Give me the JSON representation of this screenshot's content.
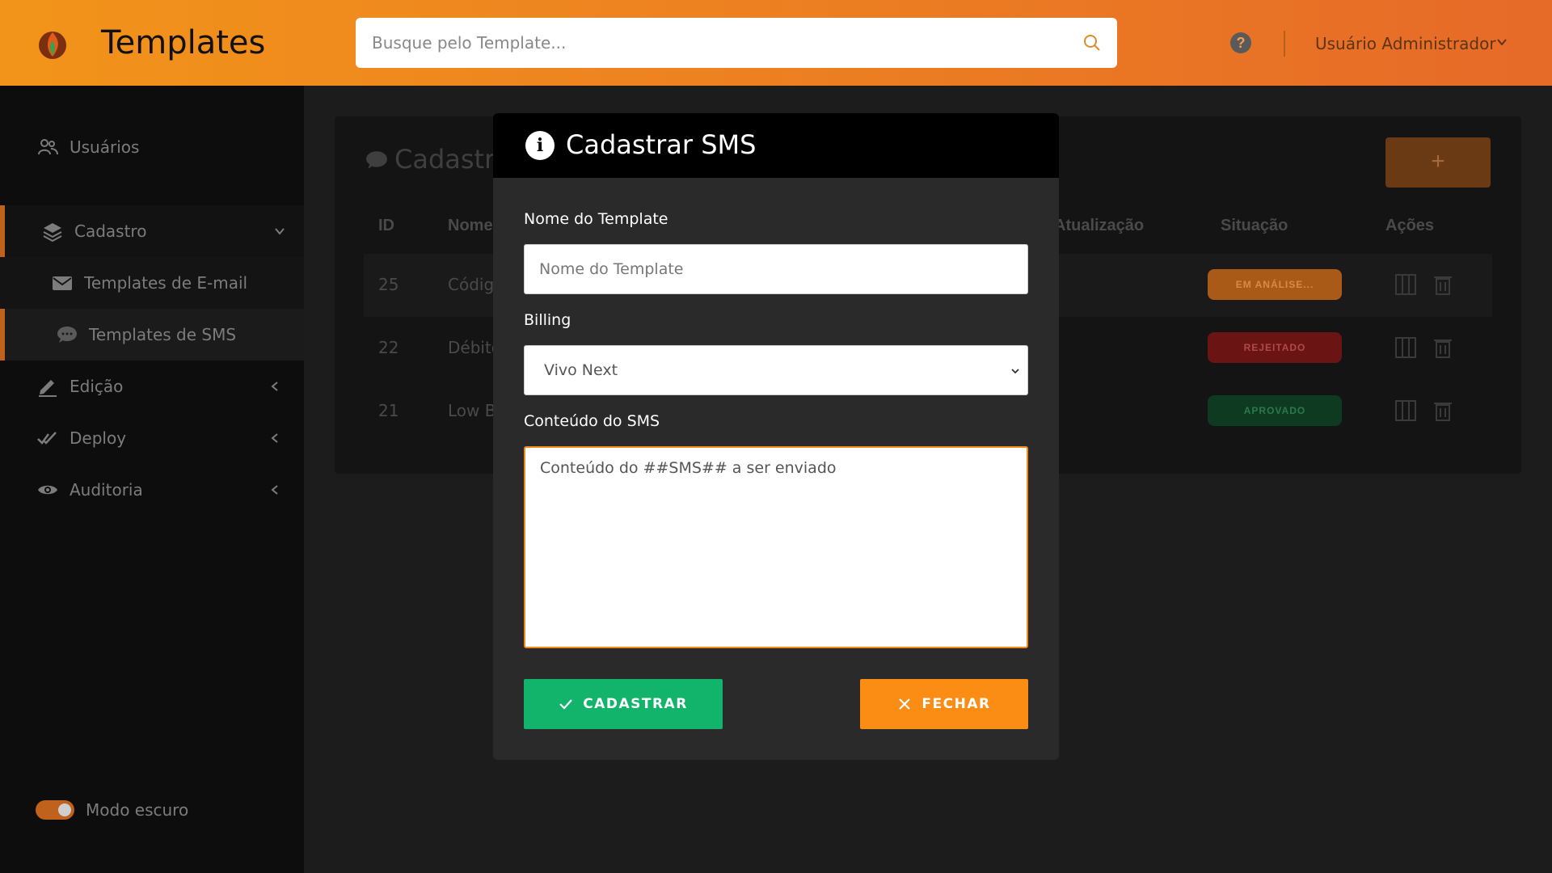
{
  "header": {
    "title": "Templates",
    "search_placeholder": "Busque pelo Template...",
    "help_glyph": "?",
    "user_name": "Usuário Administrador"
  },
  "sidebar": {
    "items": [
      {
        "label": "Usuários",
        "icon": "users-icon"
      },
      {
        "label": "Cadastro",
        "icon": "layers-icon"
      },
      {
        "label": "Templates de E-mail",
        "icon": "envelope-icon"
      },
      {
        "label": "Templates de SMS",
        "icon": "chat-bubble-icon"
      },
      {
        "label": "Edição",
        "icon": "pencil-icon"
      },
      {
        "label": "Deploy",
        "icon": "double-check-icon"
      },
      {
        "label": "Auditoria",
        "icon": "eye-icon"
      }
    ],
    "dark_mode_label": "Modo escuro"
  },
  "panel": {
    "title": "Cadastro",
    "add_glyph": "+",
    "columns": [
      "ID",
      "Nome",
      "Atualização",
      "Situação",
      "Ações"
    ],
    "rows": [
      {
        "id": "25",
        "name": "Códig",
        "status": "EM ANÁLISE...",
        "status_color": "#a85a16",
        "status_text": "#d88a4a"
      },
      {
        "id": "22",
        "name": "Débito",
        "status": "REJEITADO",
        "status_color": "#6a1414",
        "status_text": "#b04a4a"
      },
      {
        "id": "21",
        "name": "Low B",
        "status": "APROVADO",
        "status_color": "#0e3a22",
        "status_text": "#2a7a4a"
      }
    ]
  },
  "modal": {
    "title": "Cadastrar SMS",
    "info_glyph": "i",
    "name_label": "Nome do Template",
    "name_placeholder": "Nome do Template",
    "billing_label": "Billing",
    "billing_value": "Vivo Next",
    "content_label": "Conteúdo do SMS",
    "content_value": "Conteúdo do ##SMS## a ser enviado",
    "submit_label": "CADASTRAR",
    "close_label": "FECHAR"
  },
  "colors": {
    "accent": "#fb8c14",
    "success": "#12b36b",
    "header_start": "#f2941a",
    "header_end": "#e66a28"
  }
}
